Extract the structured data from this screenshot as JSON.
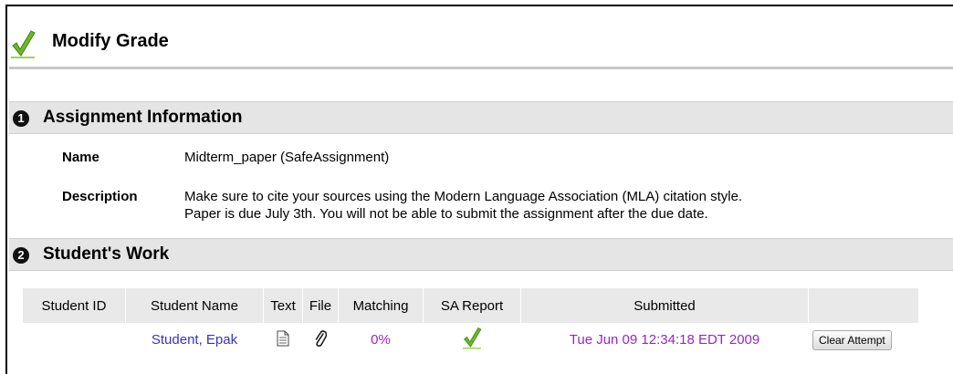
{
  "header": {
    "title": "Modify Grade",
    "icon": "checkmark-icon"
  },
  "sections": {
    "assignment": {
      "number": "1",
      "title": "Assignment Information"
    },
    "work": {
      "number": "2",
      "title": "Student's Work"
    }
  },
  "assignment": {
    "name_label": "Name",
    "name_value": "Midterm_paper (SafeAssignment)",
    "description_label": "Description",
    "description_line1": "Make sure to cite your sources using the Modern Language Association (MLA) citation style.",
    "description_line2": "Paper is due July 3th. You will not be able to submit the assignment after the due date."
  },
  "table": {
    "headers": [
      "Student ID",
      "Student Name",
      "Text",
      "File",
      "Matching",
      "SA Report",
      "Submitted",
      ""
    ],
    "row": {
      "student_id": "",
      "student_name": "Student, Epak",
      "text_icon": "document-icon",
      "file_icon": "paperclip-icon",
      "matching": "0%",
      "sa_report_icon": "checkmark-icon",
      "submitted": "Tue Jun 09 12:34:18 EDT 2009",
      "action_label": "Clear Attempt"
    }
  },
  "colors": {
    "link": "#3333cc",
    "highlight": "#9a24c8",
    "section_bg": "#e5e5e5"
  }
}
